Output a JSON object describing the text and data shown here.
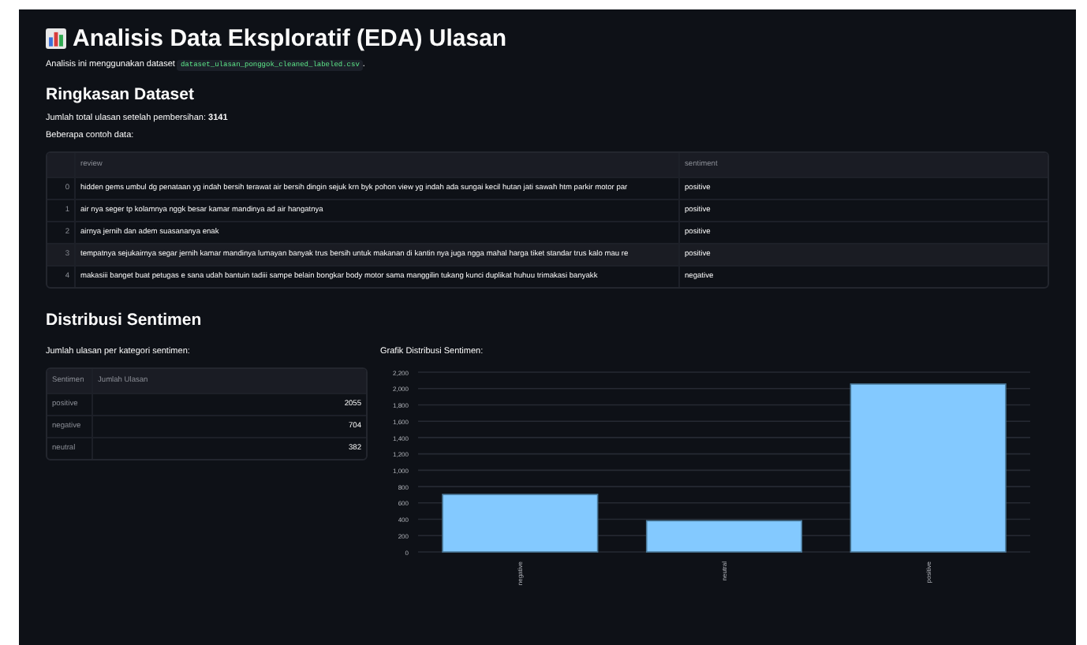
{
  "title": "Analisis Data Eksploratif (EDA) Ulasan",
  "intro": {
    "text": "Analisis ini menggunakan dataset",
    "code": "dataset_ulasan_ponggok_cleaned_labeled.csv",
    "suffix": "."
  },
  "summary": {
    "heading": "Ringkasan Dataset",
    "total_label": "Jumlah total ulasan setelah pembersihan:",
    "total_value": "3141",
    "sample_label": "Beberapa contoh data:"
  },
  "sample_table": {
    "columns": [
      "review",
      "sentiment"
    ],
    "rows": [
      {
        "index": "0",
        "review": "hidden gems umbul dg penataan yg indah bersih terawat air bersih dingin sejuk krn byk pohon view yg indah ada sungai kecil hutan jati sawah htm parkir motor par",
        "sentiment": "positive",
        "selected": false
      },
      {
        "index": "1",
        "review": "air nya seger tp kolamnya nggk besar kamar mandinya ad air hangatnya",
        "sentiment": "positive",
        "selected": false
      },
      {
        "index": "2",
        "review": "airnya jernih dan adem suasananya enak",
        "sentiment": "positive",
        "selected": false
      },
      {
        "index": "3",
        "review": "tempatnya sejukairnya segar jernih kamar mandinya lumayan banyak trus bersih untuk makanan di kantin nya juga ngga mahal harga tiket standar trus kalo mau re",
        "sentiment": "positive",
        "selected": true
      },
      {
        "index": "4",
        "review": "makasiii banget buat petugas e sana udah bantuin tadiii sampe belain bongkar body motor sama manggilin tukang kunci duplikat huhuu trimakasi banyakk",
        "sentiment": "negative",
        "selected": false
      }
    ]
  },
  "distribution": {
    "heading": "Distribusi Sentimen",
    "count_label": "Jumlah ulasan per kategori sentimen:",
    "chart_label": "Grafik Distribusi Sentimen:",
    "count_table": {
      "columns": [
        "Sentimen",
        "Jumlah Ulasan"
      ],
      "rows": [
        {
          "sentiment": "positive",
          "count": "2055"
        },
        {
          "sentiment": "negative",
          "count": "704"
        },
        {
          "sentiment": "neutral",
          "count": "382"
        }
      ]
    },
    "chart_data": {
      "type": "bar",
      "categories": [
        "negative",
        "neutral",
        "positive"
      ],
      "values": [
        704,
        382,
        2055
      ],
      "grid": true,
      "ylim": [
        0,
        2200
      ],
      "yticks": [
        {
          "value": 0,
          "label": "0"
        },
        {
          "value": 200,
          "label": "200"
        },
        {
          "value": 400,
          "label": "400"
        },
        {
          "value": 600,
          "label": "600"
        },
        {
          "value": 800,
          "label": "800"
        },
        {
          "value": 1000,
          "label": "1,000"
        },
        {
          "value": 1200,
          "label": "1,200"
        },
        {
          "value": 1400,
          "label": "1,400"
        },
        {
          "value": 1600,
          "label": "1,600"
        },
        {
          "value": 1800,
          "label": "1,800"
        },
        {
          "value": 2000,
          "label": "2,000"
        },
        {
          "value": 2200,
          "label": "2,200"
        }
      ]
    }
  }
}
